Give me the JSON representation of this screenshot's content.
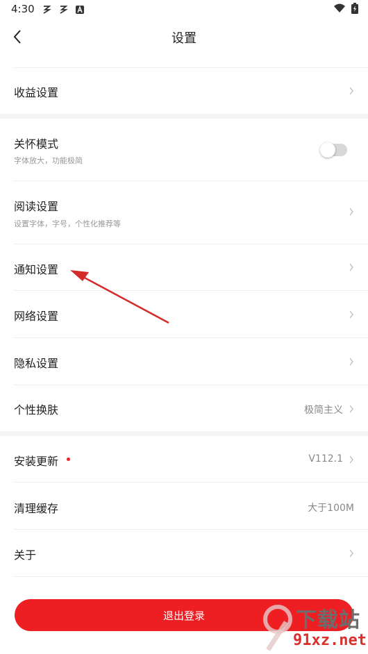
{
  "status_bar": {
    "time": "4:30"
  },
  "header": {
    "title": "设置"
  },
  "sections": {
    "income": {
      "label": "收益设置"
    },
    "care_mode": {
      "label": "关怀模式",
      "subtitle": "字体放大，功能极简",
      "enabled": false
    },
    "reading": {
      "label": "阅读设置",
      "subtitle": "设置字体，字号，个性化推荐等"
    },
    "notification": {
      "label": "通知设置"
    },
    "network": {
      "label": "网络设置"
    },
    "privacy": {
      "label": "隐私设置"
    },
    "skin": {
      "label": "个性换肤",
      "value": "极简主义"
    },
    "update": {
      "label": "安装更新",
      "value": "V112.1",
      "has_badge": true
    },
    "cache": {
      "label": "清理缓存",
      "value": "大于100M"
    },
    "about": {
      "label": "关于"
    }
  },
  "logout": {
    "label": "退出登录"
  },
  "watermark": {
    "line1": "下载站",
    "line2": "91xz.net"
  },
  "colors": {
    "accent": "#ee1f23",
    "annotation_arrow": "#d42b2b"
  }
}
